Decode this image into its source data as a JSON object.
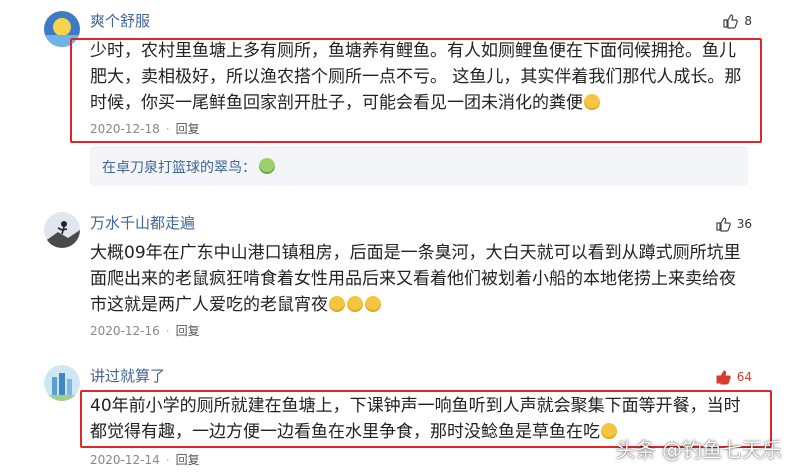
{
  "comments": [
    {
      "username": "爽个舒服",
      "likes": "8",
      "liked": false,
      "text": "少时，农村里鱼塘上多有厕所，鱼塘养有鲤鱼。有人如厕鲤鱼便在下面伺候拥抢。鱼儿肥大，卖相极好，所以渔农搭个厕所一点不亏。 这鱼儿，其实伴着我们那代人成长。那时候，你买一尾鲜鱼回家剖开肚子，可能会看见一团未消化的粪便",
      "date": "2020-12-18",
      "reply_label": "回复",
      "sub_reply_user": "在卓刀泉打篮球的翠鸟："
    },
    {
      "username": "万水千山都走遍",
      "likes": "36",
      "liked": false,
      "text": "大概09年在广东中山港口镇租房，后面是一条臭河，大白天就可以看到从蹲式厕所坑里面爬出来的老鼠疯狂啃食着女性用品后来又看着他们被划着小船的本地佬捞上来卖给夜市这就是两广人爱吃的老鼠宵夜",
      "date": "2020-12-16",
      "reply_label": "回复"
    },
    {
      "username": "讲过就算了",
      "likes": "64",
      "liked": true,
      "text": "40年前小学的厕所就建在鱼塘上，下课钟声一响鱼听到人声就会聚集下面等开餐，当时都觉得有趣，一边方便一边看鱼在水里争食，那时没鲶鱼是草鱼在吃",
      "date": "2020-12-14",
      "reply_label": "回复"
    }
  ],
  "watermark": "头条 @钓鱼七天乐",
  "colors": {
    "highlight": "#e0262c",
    "username": "#406599",
    "liked": "#d83a2e"
  },
  "icons": {
    "like": "thumbs-up-icon",
    "emoji": "laughing-emoji-icon"
  }
}
